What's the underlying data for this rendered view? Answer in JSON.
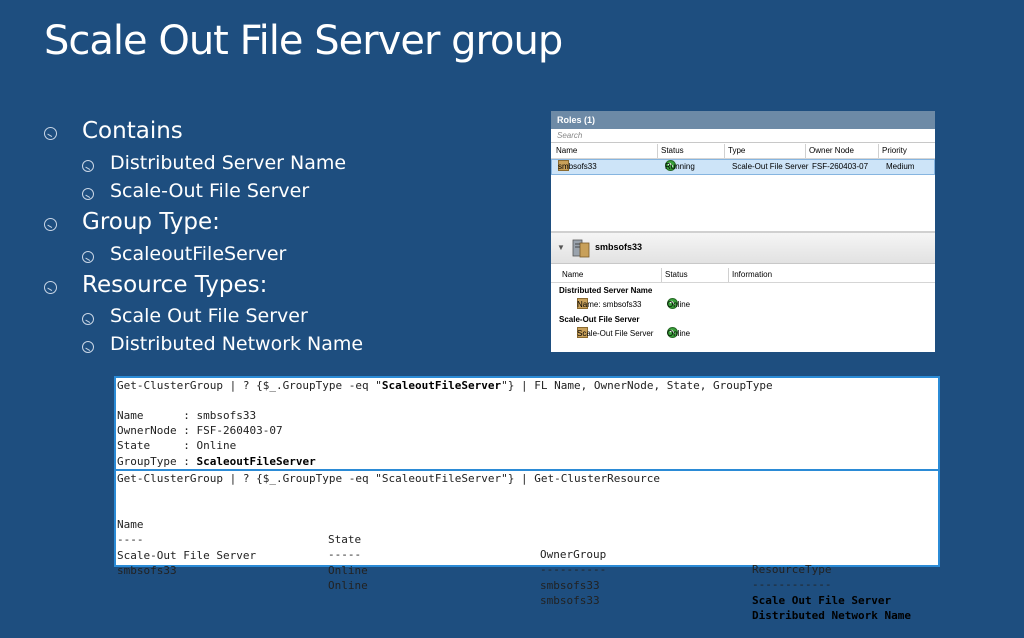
{
  "slide": {
    "title": "Scale Out File Server group"
  },
  "bullets": [
    {
      "level": 1,
      "text": "Contains"
    },
    {
      "level": 2,
      "text": "Distributed Server Name"
    },
    {
      "level": 2,
      "text": "Scale-Out File Server"
    },
    {
      "level": 1,
      "text": "Group Type:"
    },
    {
      "level": 2,
      "text": "ScaleoutFileServer"
    },
    {
      "level": 1,
      "text": "Resource Types:"
    },
    {
      "level": 2,
      "text": "Scale Out File Server"
    },
    {
      "level": 2,
      "text": "Distributed Network Name"
    }
  ],
  "roles_window": {
    "header": "Roles (1)",
    "search_placeholder": "Search",
    "columns": [
      "Name",
      "Status",
      "Type",
      "Owner Node",
      "Priority"
    ],
    "row": {
      "name": "smbsofs33",
      "status": "Running",
      "type": "Scale-Out File Server",
      "owner_node": "FSF-260403-07",
      "priority": "Medium"
    },
    "detail_title": "smbsofs33",
    "detail_columns": [
      "Name",
      "Status",
      "Information"
    ],
    "sections": [
      {
        "title": "Distributed Server Name",
        "item": "Name: smbsofs33",
        "status": "Online"
      },
      {
        "title": "Scale-Out File Server",
        "item": "Scale-Out File Server",
        "status": "Online"
      }
    ]
  },
  "console1": {
    "command_prefix": "Get-ClusterGroup | ? {$_.GroupType -eq \"",
    "command_bold": "ScaleoutFileServer",
    "command_suffix": "\"} | FL Name, OwnerNode, State, GroupType",
    "lines": [
      {
        "key": "Name      ",
        "value": "smbsofs33"
      },
      {
        "key": "OwnerNode ",
        "value": "FSF-260403-07"
      },
      {
        "key": "State     ",
        "value": "Online"
      }
    ],
    "last_key": "GroupType ",
    "last_value": "ScaleoutFileServer"
  },
  "console2": {
    "command": "Get-ClusterGroup | ? {$_.GroupType -eq \"ScaleoutFileServer\"} | Get-ClusterResource",
    "headers": [
      "Name",
      "State",
      "OwnerGroup",
      "ResourceType"
    ],
    "underlines": [
      "----",
      "-----",
      "----------",
      "------------"
    ],
    "rows": [
      [
        "Scale-Out File Server",
        "Online",
        "smbsofs33",
        "Scale Out File Server"
      ],
      [
        "smbsofs33",
        "Online",
        "smbsofs33",
        "Distributed Network Name"
      ]
    ]
  }
}
